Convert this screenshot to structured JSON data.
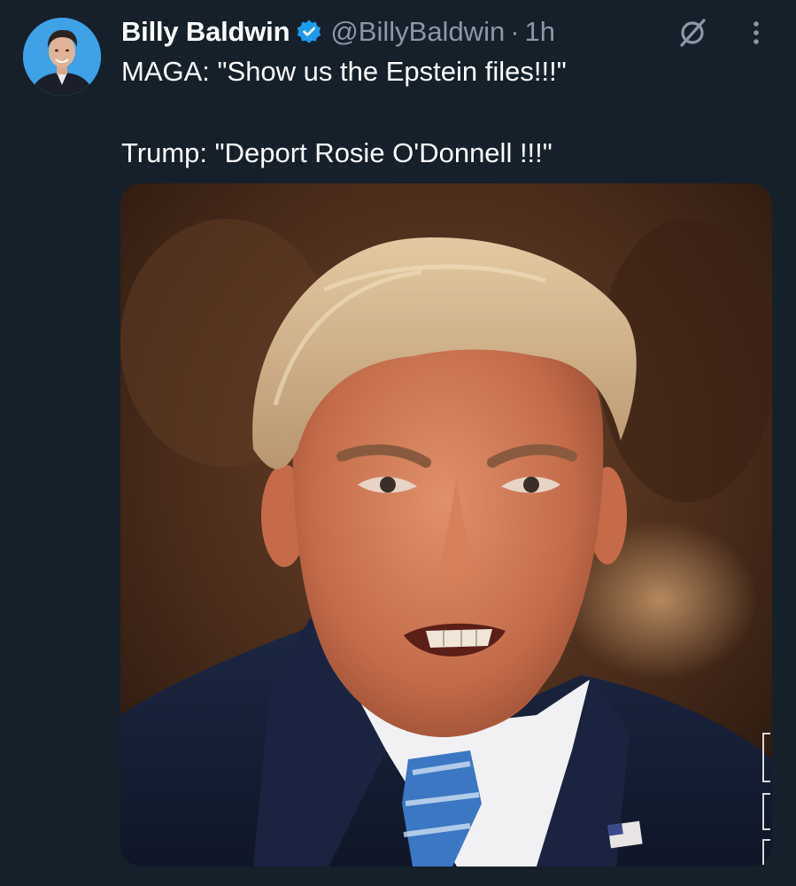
{
  "tweet": {
    "author": {
      "display_name": "Billy Baldwin",
      "handle": "@BillyBaldwin",
      "verified": true,
      "avatar_icon": "profile-photo"
    },
    "separator": "·",
    "timestamp": "1h",
    "text_lines": [
      "MAGA: \"Show us the Epstein files!!!\"",
      "Trump: \"Deport Rosie O'Donnell !!!\""
    ],
    "actions": {
      "grok_icon": "grok-icon",
      "more_icon": "more-options-icon"
    },
    "media": {
      "type": "photo",
      "description_icon": "portrait-photo"
    }
  },
  "colors": {
    "background": "#15202b",
    "text_primary": "#ffffff",
    "text_secondary": "#8b98a5",
    "verified_badge": "#1d9bf0",
    "avatar_background": "#3fa1e6"
  }
}
